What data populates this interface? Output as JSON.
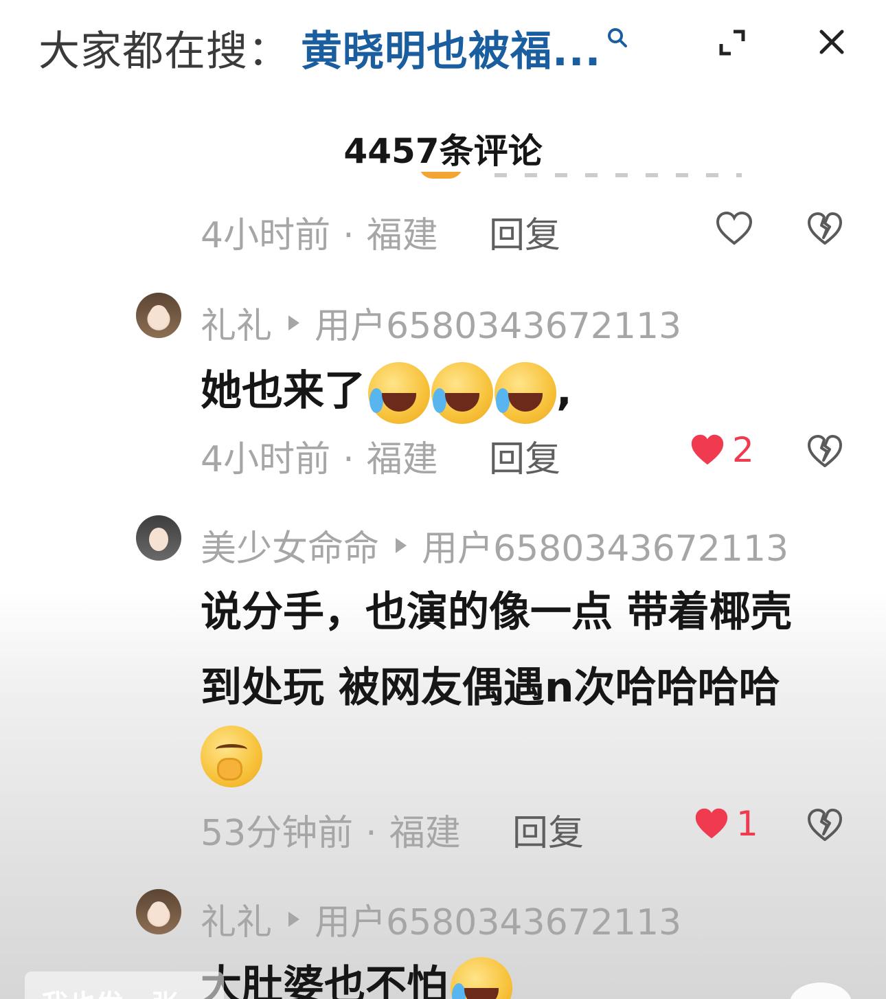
{
  "header": {
    "search_prefix": "大家都在搜：",
    "search_term": "黄晓明也被福...",
    "icons": {
      "search": "search-icon",
      "expand": "expand-icon",
      "close": "close-icon"
    }
  },
  "comment_count": "4457条评论",
  "top_meta": {
    "time": "4小时前",
    "location": "福建",
    "reply": "回复"
  },
  "comments": [
    {
      "user": "礼礼",
      "reply_to": "用户6580343672113",
      "text": "她也来了",
      "emoji_suffix": ",",
      "time": "4小时前",
      "location": "福建",
      "reply": "回复",
      "likes": "2"
    },
    {
      "user": "美少女命命",
      "reply_to": "用户6580343672113",
      "text_lines": [
        "说分手，也演的像一点 带着椰壳",
        "到处玩 被网友偶遇n次哈哈哈哈"
      ],
      "time": "53分钟前",
      "location": "福建",
      "reply": "回复",
      "likes": "1"
    },
    {
      "user": "礼礼",
      "reply_to": "用户6580343672113",
      "text": "大肚婆也不怕"
    }
  ],
  "bottom_bar": {
    "text": "我也发一张"
  },
  "colors": {
    "accent_link": "#1b5ea0",
    "like_red": "#f03a50",
    "meta_gray": "#a6a6a6"
  }
}
